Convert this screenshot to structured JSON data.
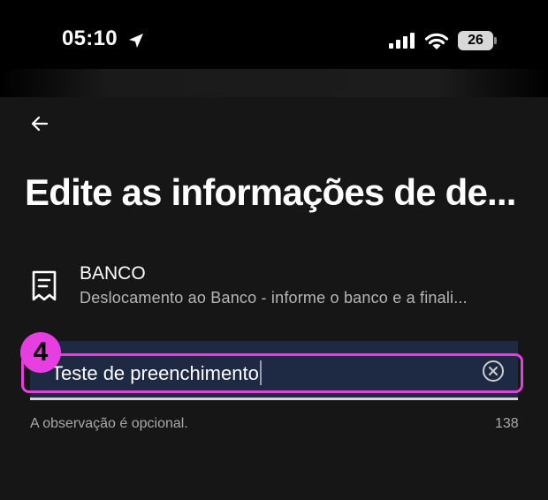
{
  "status_bar": {
    "time": "05:10",
    "battery": "26",
    "icons": [
      "location-arrow-icon",
      "cellular-signal-icon",
      "wifi-icon",
      "battery-icon"
    ]
  },
  "header": {
    "back_icon": "arrow-left-icon",
    "title": "Edite as informações de de..."
  },
  "category": {
    "icon": "receipt-icon",
    "name": "BANCO",
    "description": "Deslocamento ao Banco - informe o banco e a finali..."
  },
  "note_input": {
    "value": "Teste de preenchimento",
    "clear_icon": "clear-circle-x-icon",
    "helper": "A observação é opcional.",
    "remaining_chars": "138"
  },
  "annotation": {
    "step": "4",
    "color": "#e63ee0"
  },
  "colors": {
    "background": "#000000",
    "sheet": "#161616",
    "input_background": "#1e2a44",
    "annotation": "#e63ee0"
  }
}
